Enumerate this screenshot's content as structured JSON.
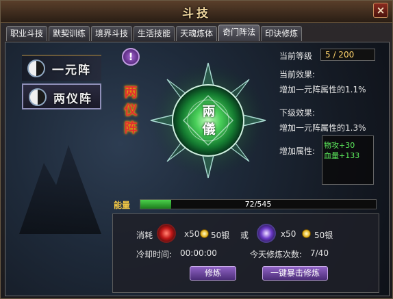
{
  "window": {
    "title": "斗技",
    "close_label": "×"
  },
  "tabs": [
    {
      "label": "职业斗技",
      "active": false
    },
    {
      "label": "默契训练",
      "active": false
    },
    {
      "label": "境界斗技",
      "active": false
    },
    {
      "label": "生活技能",
      "active": false
    },
    {
      "label": "天魂炼体",
      "active": false
    },
    {
      "label": "奇门阵法",
      "active": true
    },
    {
      "label": "印诀修炼",
      "active": false
    }
  ],
  "formations": [
    {
      "name": "一元阵",
      "selected": false
    },
    {
      "name": "两仪阵",
      "selected": true
    }
  ],
  "selected_formation": {
    "vertical_name": [
      "两",
      "仪",
      "阵"
    ],
    "emblem_text": [
      "兩",
      "儀"
    ],
    "info_icon": "!"
  },
  "stats": {
    "level_label": "当前等级",
    "level_value": "5 / 200",
    "current_effect_label": "当前效果:",
    "current_effect_value": "增加一元阵属性的1.1%",
    "next_effect_label": "下级效果:",
    "next_effect_value": "增加一元阵属性的1.3%",
    "added_attr_label": "增加属性:",
    "added_attrs": [
      "物攻+30",
      "血量+133"
    ]
  },
  "energy": {
    "label": "能量",
    "current": 72,
    "max": 545,
    "text": "72/545"
  },
  "cost": {
    "label": "消耗",
    "option1_qty": "x50",
    "option1_silver": "50银",
    "or_label": "或",
    "option2_qty": "x50",
    "option2_silver": "50银",
    "cooldown_label": "冷却时间:",
    "cooldown_value": "00:00:00",
    "daily_label": "今天修炼次数:",
    "daily_value": "7/40"
  },
  "buttons": {
    "train": "修炼",
    "crit_train": "一键暴击修炼"
  },
  "colors": {
    "accent_gold": "#f2c744",
    "attr_green": "#5ef05e",
    "name_red": "#e03030",
    "button_purple": "#8f62c4",
    "energy_green": "#4bd24b"
  }
}
